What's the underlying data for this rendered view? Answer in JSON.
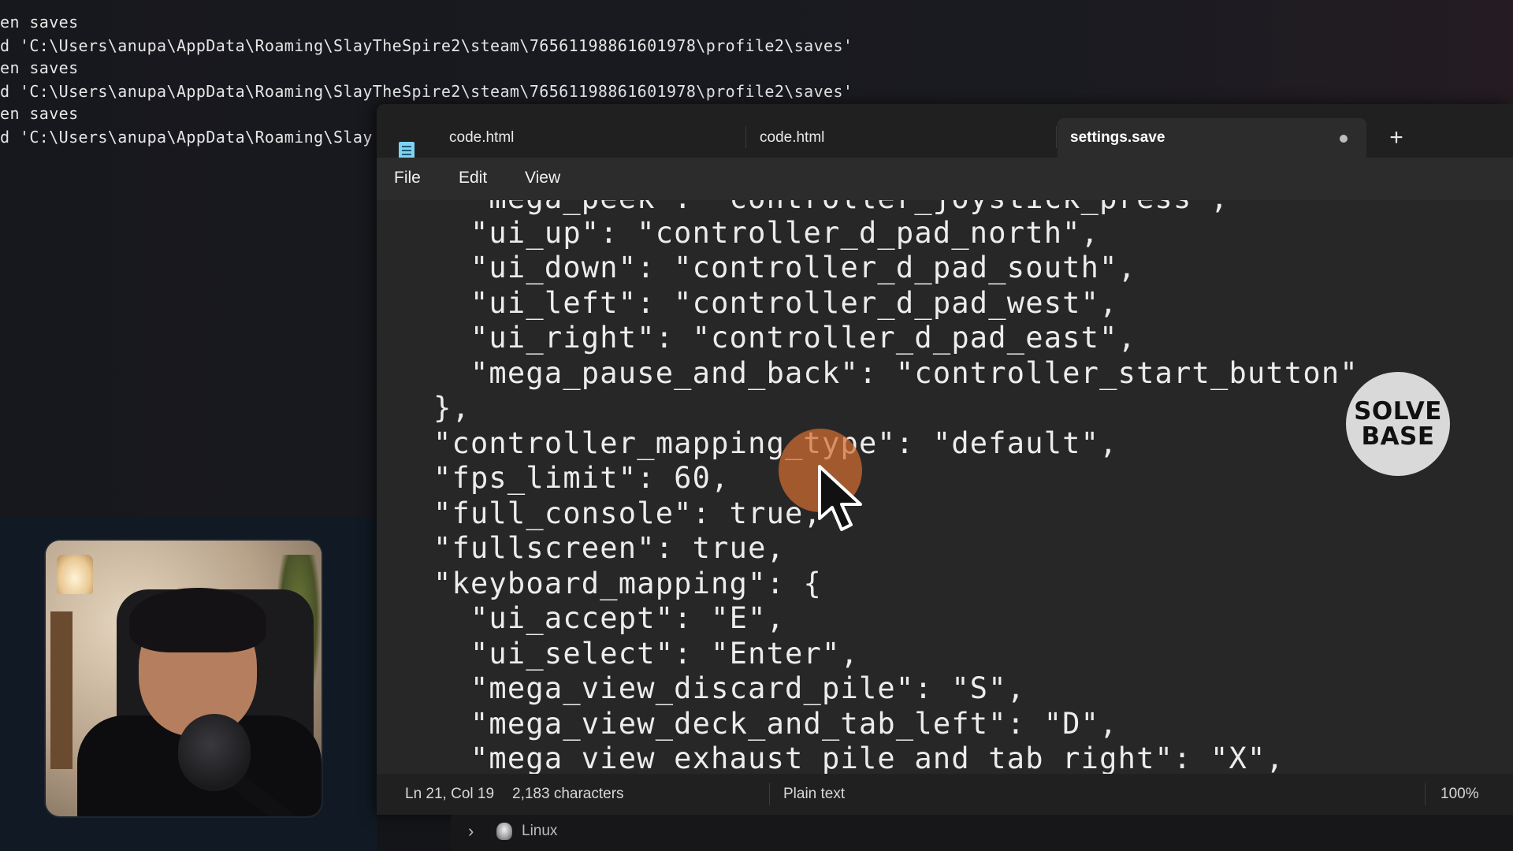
{
  "terminal": {
    "lines": [
      "en saves",
      "d 'C:\\Users\\anupa\\AppData\\Roaming\\SlayTheSpire2\\steam\\76561198861601978\\profile2\\saves'",
      "en saves",
      "d 'C:\\Users\\anupa\\AppData\\Roaming\\SlayTheSpire2\\steam\\76561198861601978\\profile2\\saves'",
      "en saves",
      "d 'C:\\Users\\anupa\\AppData\\Roaming\\Slay"
    ]
  },
  "editor": {
    "tabs": [
      {
        "label": "code.html"
      },
      {
        "label": "code.html"
      },
      {
        "label": "settings.save"
      }
    ],
    "new_tab_label": "+",
    "menu": [
      "File",
      "Edit",
      "View"
    ],
    "code_lines": [
      "  \"mega_peek\": \"controller_joystick_press\",",
      "  \"ui_up\": \"controller_d_pad_north\",",
      "  \"ui_down\": \"controller_d_pad_south\",",
      "  \"ui_left\": \"controller_d_pad_west\",",
      "  \"ui_right\": \"controller_d_pad_east\",",
      "  \"mega_pause_and_back\": \"controller_start_button\"",
      "},",
      "\"controller_mapping_type\": \"default\",",
      "\"fps_limit\": 60,",
      "\"full_console\": true,",
      "\"fullscreen\": true,",
      "\"keyboard_mapping\": {",
      "  \"ui_accept\": \"E\",",
      "  \"ui_select\": \"Enter\",",
      "  \"mega_view_discard_pile\": \"S\",",
      "  \"mega_view_deck_and_tab_left\": \"D\",",
      "  \"mega_view_exhaust_pile_and_tab_right\": \"X\","
    ],
    "status": {
      "position": "Ln 21, Col 19",
      "characters": "2,183 characters",
      "file_type": "Plain text",
      "zoom": "100%"
    }
  },
  "bottom_strip": {
    "label": "Linux"
  },
  "logo": {
    "line1": "SOLVE",
    "line2": "BASE"
  },
  "colors": {
    "editor_bg": "#272727",
    "cursor_highlight": "#d26e32"
  }
}
